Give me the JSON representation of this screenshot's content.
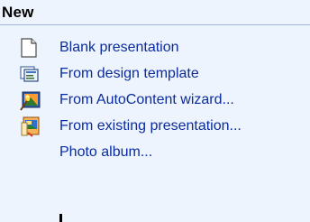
{
  "section": {
    "title": "New"
  },
  "items": [
    {
      "label": "Blank presentation",
      "icon": "blank-document-icon"
    },
    {
      "label": "From design template",
      "icon": "design-template-icon"
    },
    {
      "label": "From AutoContent wizard...",
      "icon": "autocontent-wizard-icon"
    },
    {
      "label": "From existing presentation...",
      "icon": "existing-presentation-icon"
    },
    {
      "label": "Photo album...",
      "icon": null
    }
  ],
  "colors": {
    "background": "#eef4fd",
    "link": "#0b2c9e",
    "divider": "#9fb8dd"
  }
}
